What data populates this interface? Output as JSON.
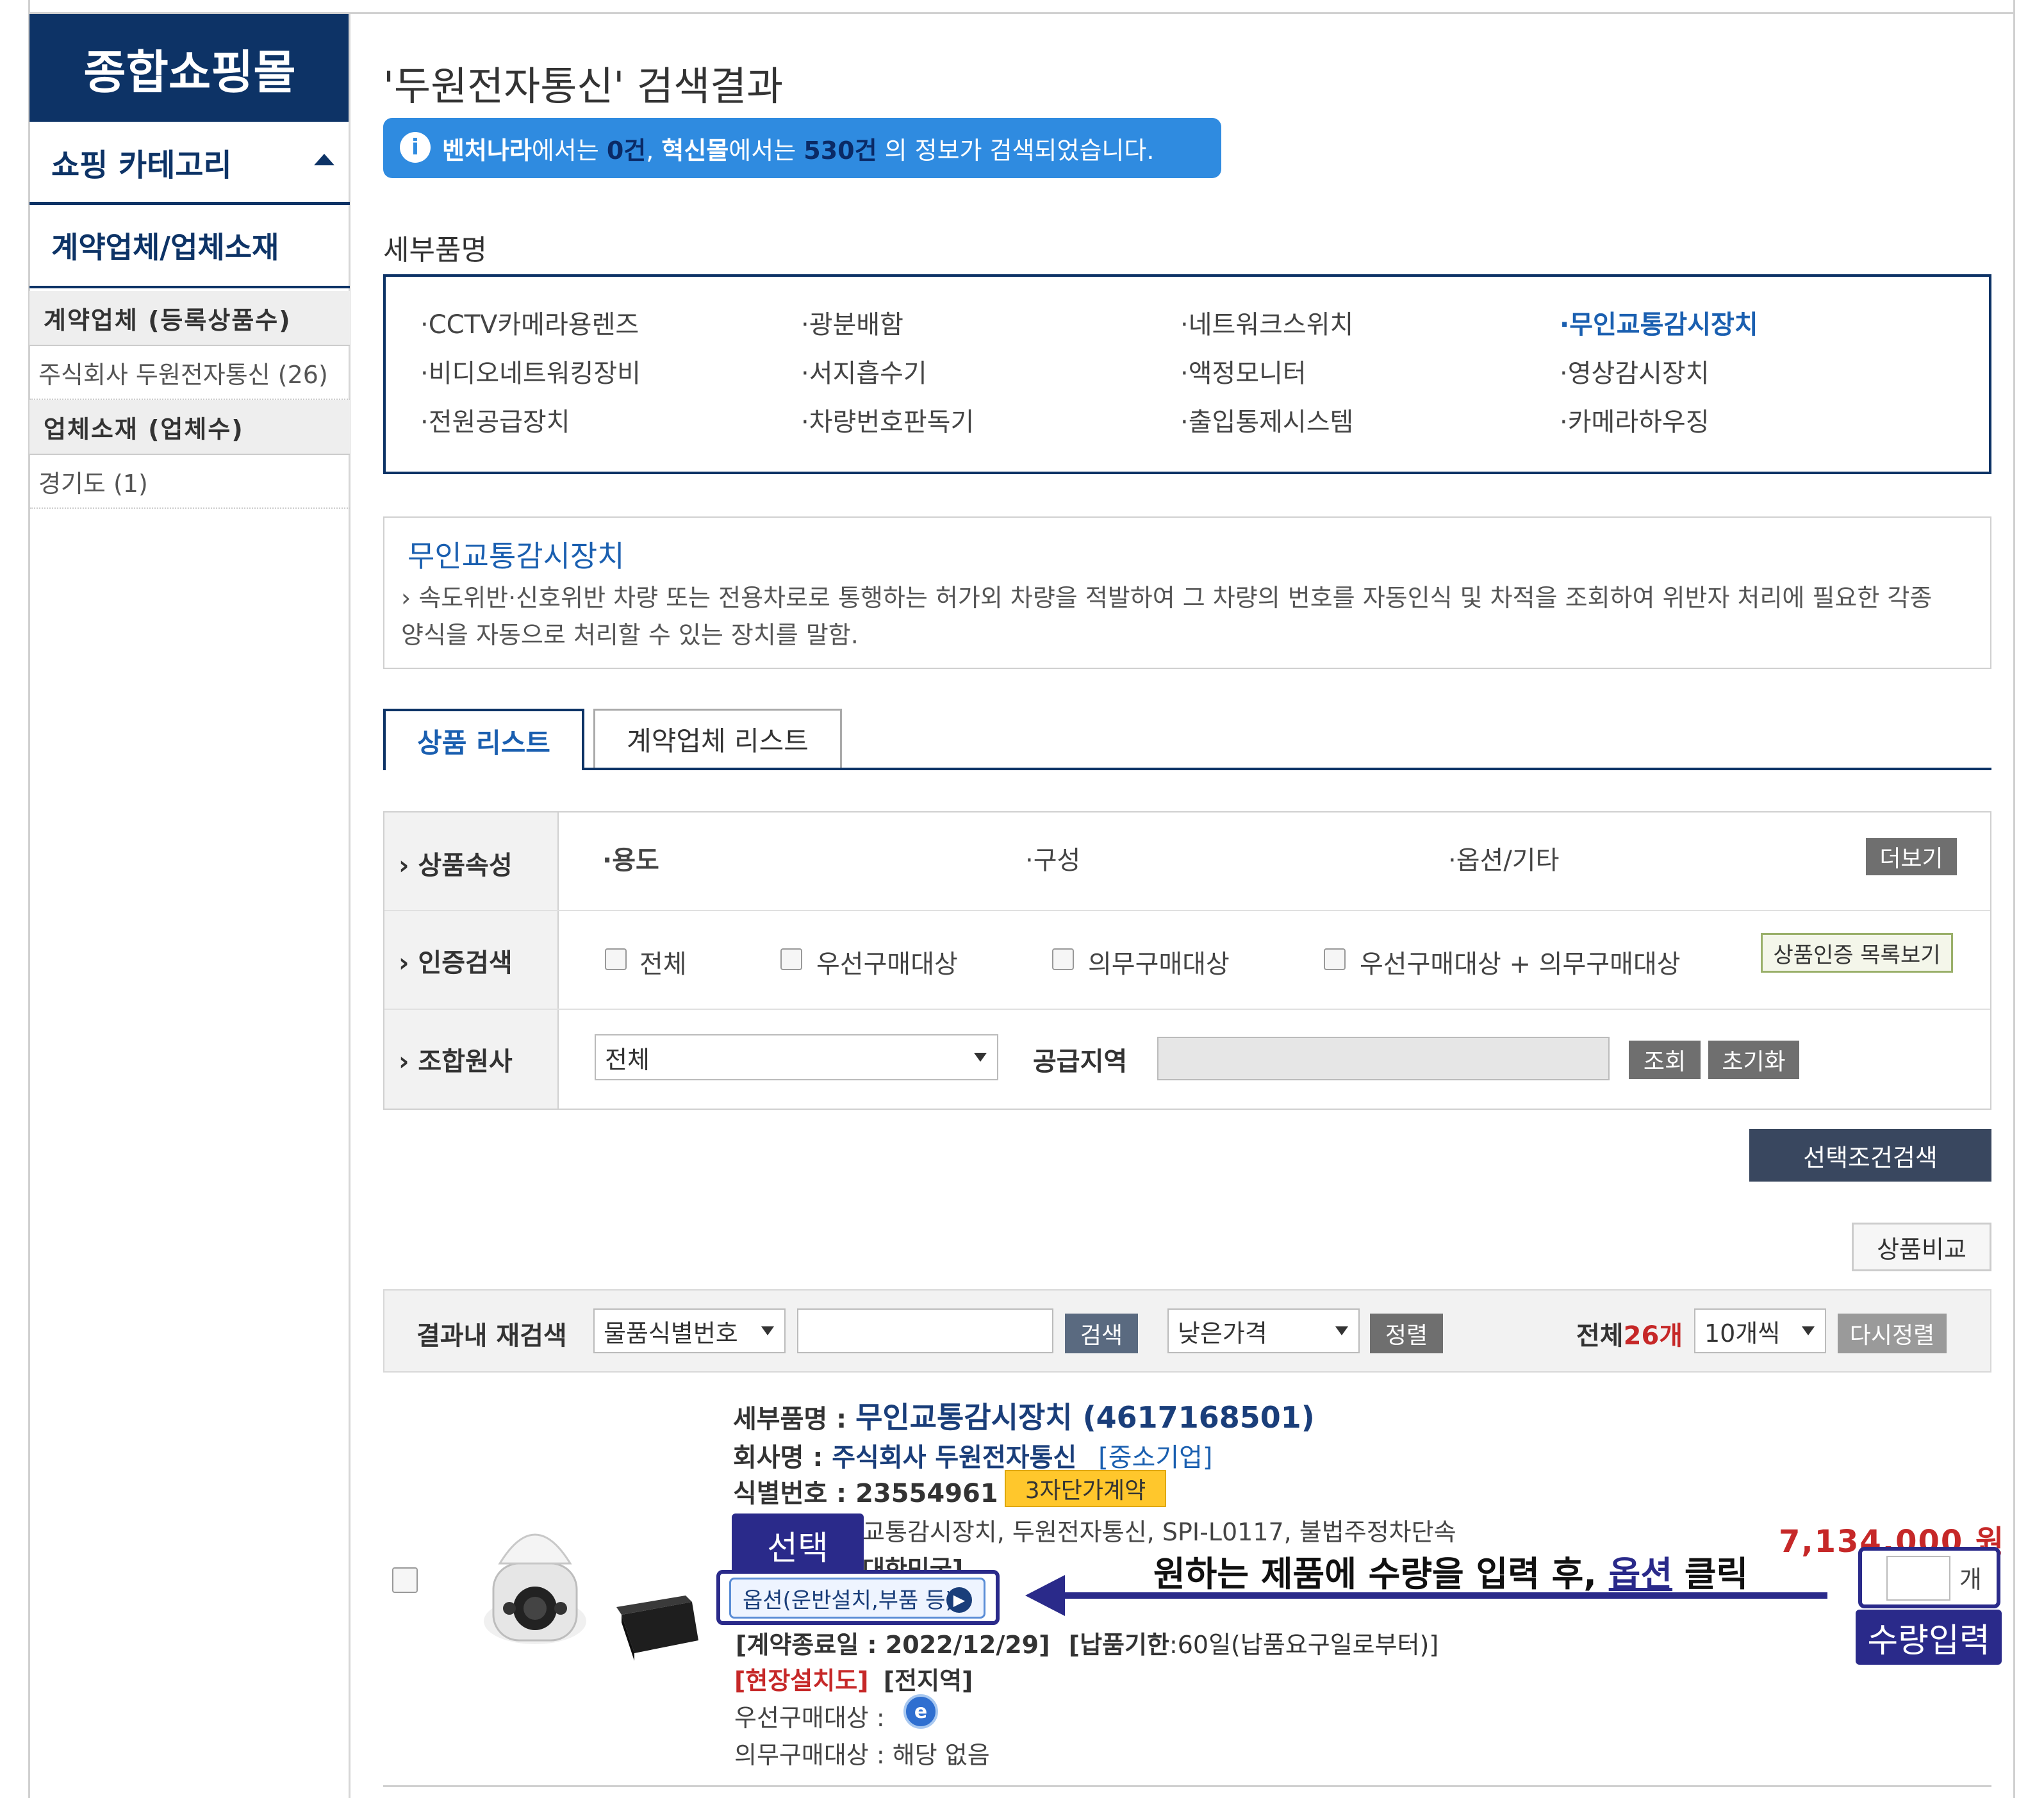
{
  "sidebar": {
    "title": "종합쇼핑몰",
    "category_label": "쇼핑 카테고리",
    "sub_label": "계약업체/업체소재",
    "contract_head": "계약업체 (등록상품수)",
    "contract_item": "주식회사 두원전자통신 (26)",
    "location_head": "업체소재 (업체수)",
    "location_item": "경기도 (1)"
  },
  "header": {
    "title": "'두원전자통신' 검색결과",
    "banner_part1": "벤처나라",
    "banner_part2": "에서는 ",
    "banner_count1": "0건",
    "banner_part3": ", ",
    "banner_part4": "혁신몰",
    "banner_part5": "에서는 ",
    "banner_count2": "530건",
    "banner_part6": " 의 정보가 검색되었습니다."
  },
  "categories": {
    "label": "세부품명",
    "items": [
      "CCTV카메라용렌즈",
      "광분배함",
      "네트워크스위치",
      "무인교통감시장치",
      "비디오네트워킹장비",
      "서지흡수기",
      "액정모니터",
      "영상감시장치",
      "전원공급장치",
      "차량번호판독기",
      "출입통제시스템",
      "카메라하우징"
    ]
  },
  "description": {
    "title": "무인교통감시장치",
    "text": "속도위반·신호위반 차량 또는 전용차로로 통행하는 허가외 차량을 적발하여 그 차량의 번호를 자동인식 및 차적을 조회하여 위반자 처리에 필요한 각종 양식을 자동으로 처리할 수 있는 장치를 말함."
  },
  "tabs": [
    "상품 리스트",
    "계약업체 리스트"
  ],
  "filters": {
    "attr_label": "상품속성",
    "attr_options": [
      "용도",
      "구성",
      "옵션/기타"
    ],
    "more_button": "더보기",
    "cert_label": "인증검색",
    "cert_options": [
      "전체",
      "우선구매대상",
      "의무구매대상",
      "우선구매대상 + 의무구매대상"
    ],
    "cert_button": "상품인증 목록보기",
    "union_label": "조합원사",
    "union_select": "전체",
    "region_label": "공급지역",
    "lookup_button": "조회",
    "reset_button": "초기화",
    "search_button": "선택조건검색"
  },
  "compare_button": "상품비교",
  "results_bar": {
    "label": "결과내 재검색",
    "field_select": "물품식별번호",
    "search_button": "검색",
    "sort_select": "낮은가격",
    "sort_button": "정렬",
    "total_prefix": "전체",
    "total_count": "26개",
    "per_page": "10개씩",
    "resort_button": "다시정렬"
  },
  "product": {
    "detail_name_label": "세부품명 : ",
    "detail_name": "무인교통감시장치 (4617168501)",
    "company_label": "회사명 : ",
    "company": "주식회사 두원전자통신",
    "company_type": "[중소기업]",
    "id_label": "식별번호 : ",
    "id": "23554961",
    "contract_badge": "3자단가계약",
    "spec_line": "교통감시장치, 두원전자통신, SPI-L0117, 불법주정차단속",
    "origin_partial": "대한민국]",
    "contract_line_partial": "[계약종료일 : 2022/12/29]",
    "delivery_label": "[납품기한",
    "delivery_value": ":60일(납품요구일로부터)]",
    "install": "[현장설치도]",
    "region": "[전지역]",
    "priority_label": "우선구매대상 : ",
    "mandatory_label": "의무구매대상 : ",
    "mandatory_value": "해당 없음",
    "price": "7,134,000 원",
    "option_button": "옵션(운반설치,부품 등)",
    "qty_unit": "개"
  },
  "annotations": {
    "select_label": "선택",
    "qty_label": "수량입력",
    "instruction_part1": "원하는 제품에 수량을 입력 후, ",
    "instruction_highlight": "옵션",
    "instruction_part2": " 클릭"
  },
  "colors": {
    "navy": "#0d3366",
    "banner_blue": "#2f8be0",
    "link_blue": "#1a5fb0",
    "price_red": "#c62828",
    "callout": "#2a2a8a"
  }
}
